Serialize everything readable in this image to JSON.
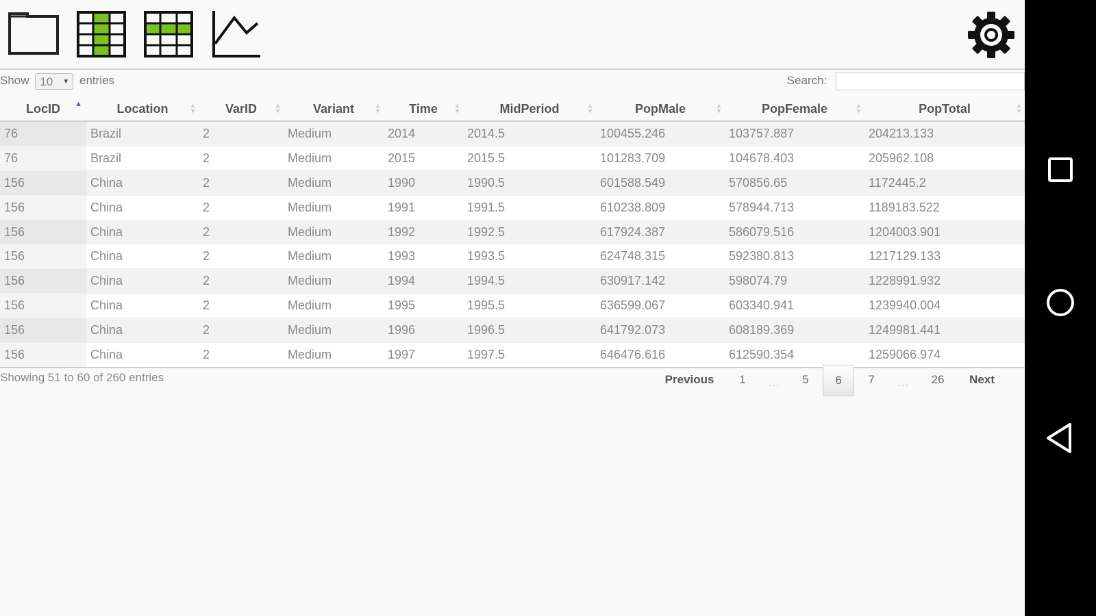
{
  "controls": {
    "show_label": "Show",
    "length_value": "10",
    "entries_label": "entries",
    "search_label": "Search:",
    "search_value": ""
  },
  "table": {
    "columns": [
      "LocID",
      "Location",
      "VarID",
      "Variant",
      "Time",
      "MidPeriod",
      "PopMale",
      "PopFemale",
      "PopTotal"
    ],
    "sorted_column": "LocID",
    "sort_direction": "ascending",
    "rows": [
      [
        "76",
        "Brazil",
        "2",
        "Medium",
        "2014",
        "2014.5",
        "100455.246",
        "103757.887",
        "204213.133"
      ],
      [
        "76",
        "Brazil",
        "2",
        "Medium",
        "2015",
        "2015.5",
        "101283.709",
        "104678.403",
        "205962.108"
      ],
      [
        "156",
        "China",
        "2",
        "Medium",
        "1990",
        "1990.5",
        "601588.549",
        "570856.65",
        "1172445.2"
      ],
      [
        "156",
        "China",
        "2",
        "Medium",
        "1991",
        "1991.5",
        "610238.809",
        "578944.713",
        "1189183.522"
      ],
      [
        "156",
        "China",
        "2",
        "Medium",
        "1992",
        "1992.5",
        "617924.387",
        "586079.516",
        "1204003.901"
      ],
      [
        "156",
        "China",
        "2",
        "Medium",
        "1993",
        "1993.5",
        "624748.315",
        "592380.813",
        "1217129.133"
      ],
      [
        "156",
        "China",
        "2",
        "Medium",
        "1994",
        "1994.5",
        "630917.142",
        "598074.79",
        "1228991.932"
      ],
      [
        "156",
        "China",
        "2",
        "Medium",
        "1995",
        "1995.5",
        "636599.067",
        "603340.941",
        "1239940.004"
      ],
      [
        "156",
        "China",
        "2",
        "Medium",
        "1996",
        "1996.5",
        "641792.073",
        "608189.369",
        "1249981.441"
      ],
      [
        "156",
        "China",
        "2",
        "Medium",
        "1997",
        "1997.5",
        "646476.616",
        "612590.354",
        "1259066.974"
      ]
    ]
  },
  "footer": {
    "info": "Showing 51 to 60 of 260 entries",
    "previous": "Previous",
    "next": "Next",
    "ellipsis": "…",
    "pages": [
      "1",
      "5",
      "6",
      "7",
      "26"
    ],
    "current_page": "6"
  },
  "toolbar": {
    "icons": [
      "folder-icon",
      "table-green-columns-icon",
      "table-green-rows-icon",
      "line-chart-icon",
      "gear-icon"
    ],
    "accent": "#7cc21e"
  },
  "android_nav": {
    "icons": [
      "recent-apps-icon",
      "home-icon",
      "back-icon"
    ],
    "background": "#000000"
  }
}
